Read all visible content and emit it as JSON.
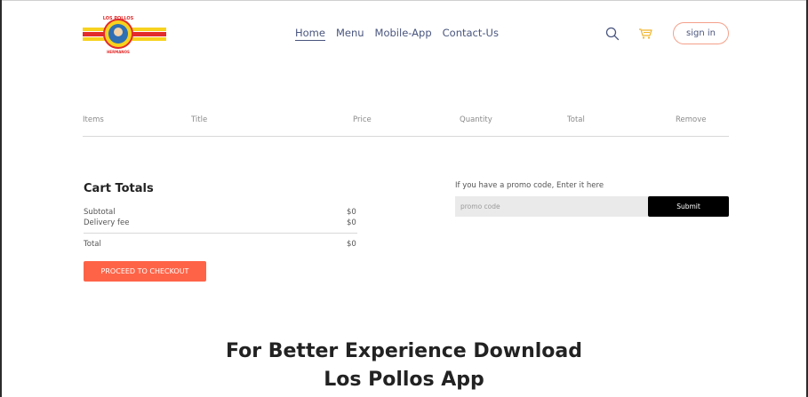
{
  "brand": {
    "logo_text_top": "LOS POLLOS",
    "logo_text_bottom": "HERMANOS",
    "colors": {
      "red": "#e32b2b",
      "yellow": "#f7d21e",
      "blue": "#2f6fb3",
      "accent": "#ff6347",
      "nav_text": "#49557e"
    }
  },
  "nav": {
    "items": [
      {
        "label": "Home",
        "active": true
      },
      {
        "label": "Menu",
        "active": false
      },
      {
        "label": "Mobile-App",
        "active": false
      },
      {
        "label": "Contact-Us",
        "active": false
      }
    ],
    "signin_label": "sign in",
    "icons": [
      "search-icon",
      "basket-icon"
    ]
  },
  "cart": {
    "columns": [
      "Items",
      "Title",
      "Price",
      "Quantity",
      "Total",
      "Remove"
    ]
  },
  "totals": {
    "title": "Cart Totals",
    "subtotal_label": "Subtotal",
    "subtotal_value": "$0",
    "delivery_label": "Delivery fee",
    "delivery_value": "$0",
    "total_label": "Total",
    "total_value": "$0",
    "checkout_label": "PROCEED TO CHECKOUT"
  },
  "promo": {
    "label": "If you have a promo code, Enter it here",
    "placeholder": "promo code",
    "submit_label": "Submit"
  },
  "app_download": {
    "line1": "For Better Experience Download",
    "line2": "Los Pollos App"
  }
}
